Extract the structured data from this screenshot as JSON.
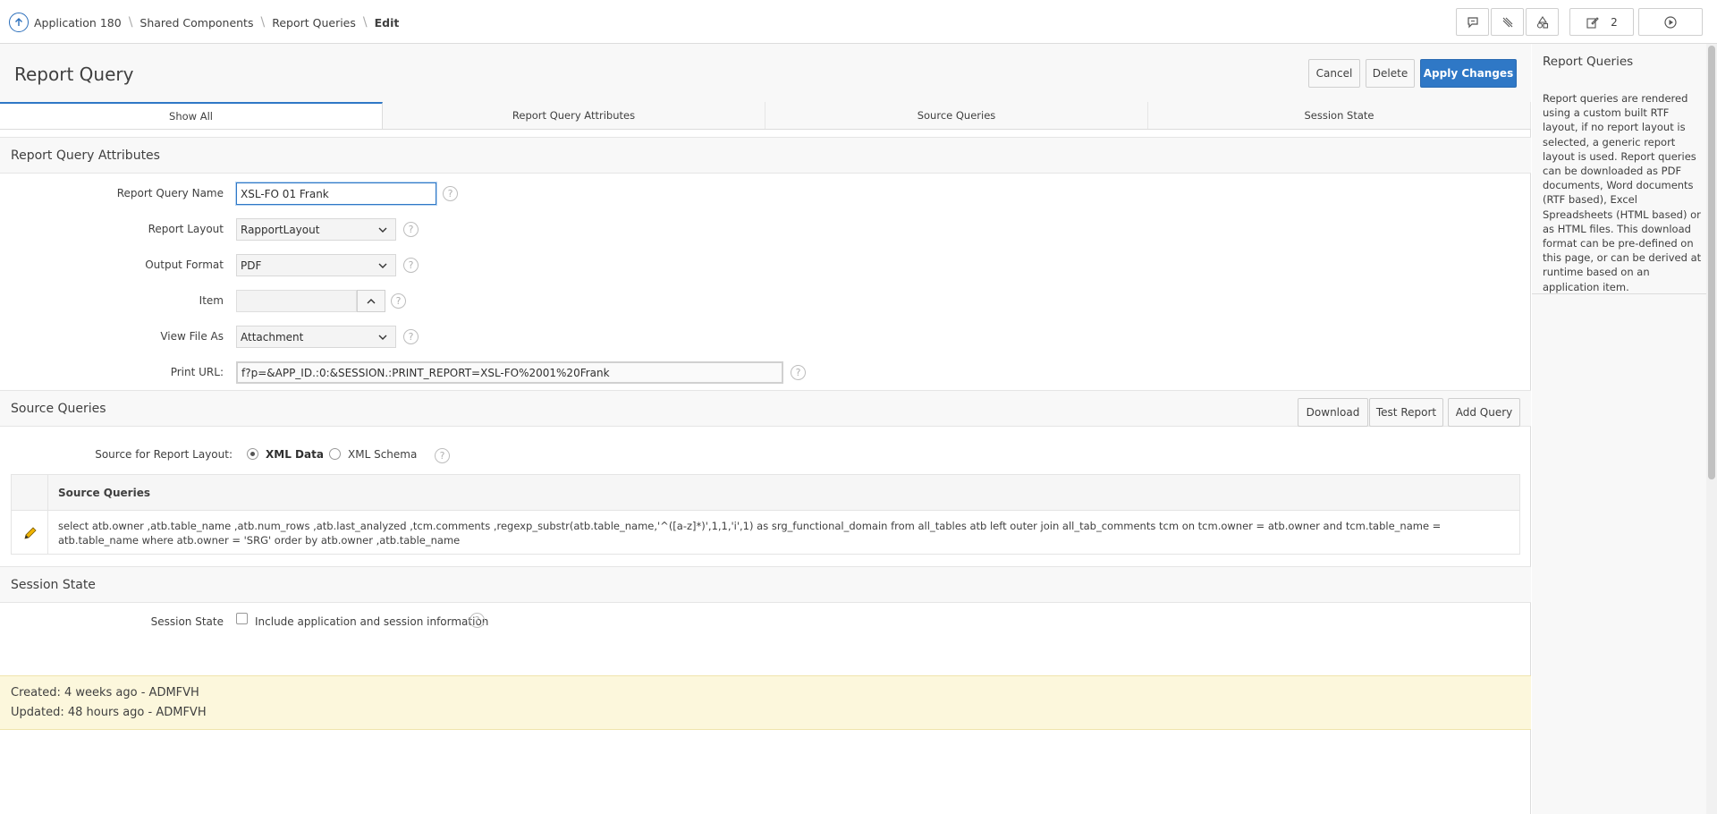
{
  "breadcrumb": {
    "items": [
      "Application 180",
      "Shared Components",
      "Report Queries"
    ],
    "current": "Edit"
  },
  "toolbar": {
    "developer_count": "2"
  },
  "page": {
    "title": "Report Query",
    "cancel_label": "Cancel",
    "delete_label": "Delete",
    "apply_label": "Apply Changes"
  },
  "tabs": [
    {
      "label": "Show All",
      "active": true
    },
    {
      "label": "Report Query Attributes",
      "active": false
    },
    {
      "label": "Source Queries",
      "active": false
    },
    {
      "label": "Session State",
      "active": false
    }
  ],
  "attributes": {
    "title": "Report Query Attributes",
    "name_label": "Report Query Name",
    "name_value": "XSL-FO 01 Frank",
    "layout_label": "Report Layout",
    "layout_value": "RapportLayout",
    "format_label": "Output Format",
    "format_value": "PDF",
    "item_label": "Item",
    "item_value": "",
    "viewas_label": "View File As",
    "viewas_value": "Attachment",
    "url_label": "Print URL:",
    "url_value": "f?p=&APP_ID.:0:&SESSION.:PRINT_REPORT=XSL-FO%2001%20Frank"
  },
  "source_queries": {
    "title": "Source Queries",
    "download_label": "Download",
    "test_label": "Test Report",
    "add_label": "Add Query",
    "source_label": "Source for Report Layout:",
    "xml_data_label": "XML Data",
    "xml_schema_label": "XML Schema",
    "table_header": "Source Queries",
    "sql": "select atb.owner ,atb.table_name ,atb.num_rows ,atb.last_analyzed ,tcm.comments ,regexp_substr(atb.table_name,'^([a-z]*)',1,1,'i',1) as srg_functional_domain from all_tables atb left outer join all_tab_comments tcm on tcm.owner = atb.owner and tcm.table_name = atb.table_name where atb.owner = 'SRG' order by atb.owner ,atb.table_name"
  },
  "session_state": {
    "title": "Session State",
    "label": "Session State",
    "checkbox_label": "Include application and session information"
  },
  "audit": {
    "created": "Created: 4 weeks ago - ADMFVH",
    "updated": "Updated: 48 hours ago - ADMFVH"
  },
  "sidebar": {
    "title": "Report Queries",
    "text": "Report queries are rendered using a custom built RTF layout, if no report layout is selected, a generic report layout is used. Report queries can be downloaded as PDF documents, Word documents (RTF based), Excel Spreadsheets (HTML based) or as HTML files. This download format can be pre-defined on this page, or can be derived at runtime based on an application item."
  },
  "colors": {
    "accent": "#2f78c6",
    "audit_bg": "#fcf7dc"
  }
}
